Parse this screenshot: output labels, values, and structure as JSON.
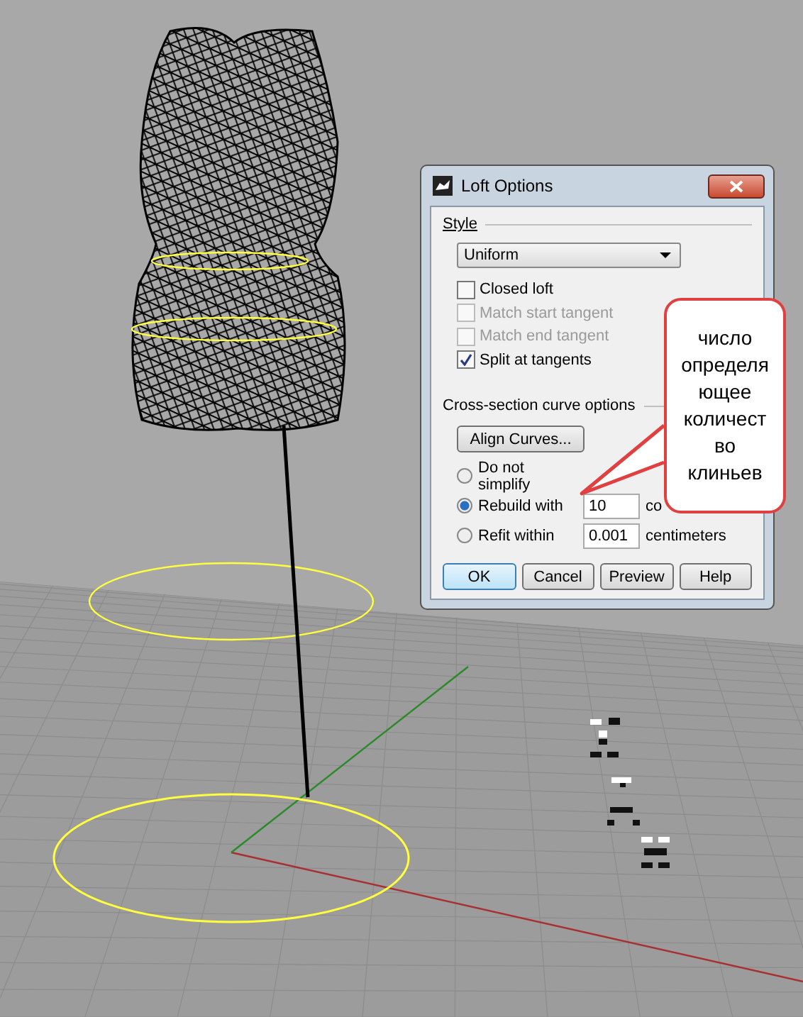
{
  "dialog": {
    "title": "Loft Options",
    "style_label": "Style",
    "style_value": "Uniform",
    "checkboxes": [
      {
        "label": "Closed loft",
        "checked": false,
        "disabled": false
      },
      {
        "label": "Match start tangent",
        "checked": false,
        "disabled": true
      },
      {
        "label": "Match end tangent",
        "checked": false,
        "disabled": true
      },
      {
        "label": "Split at tangents",
        "checked": true,
        "disabled": false
      }
    ],
    "section_label": "Cross-section curve options",
    "align_button": "Align Curves...",
    "radios": [
      {
        "label": "Do not simplify",
        "selected": false
      },
      {
        "label": "Rebuild with",
        "selected": true,
        "value": "10",
        "unit": "co"
      },
      {
        "label": "Refit within",
        "selected": false,
        "value": "0.001",
        "unit": "centimeters"
      }
    ],
    "buttons": [
      {
        "label": "OK",
        "default": true
      },
      {
        "label": "Cancel",
        "default": false
      },
      {
        "label": "Preview",
        "default": false
      },
      {
        "label": "Help",
        "default": false
      }
    ]
  },
  "callout": {
    "lines": [
      "число",
      "определя",
      "ющее",
      "количест",
      "во",
      "клиньев"
    ]
  }
}
